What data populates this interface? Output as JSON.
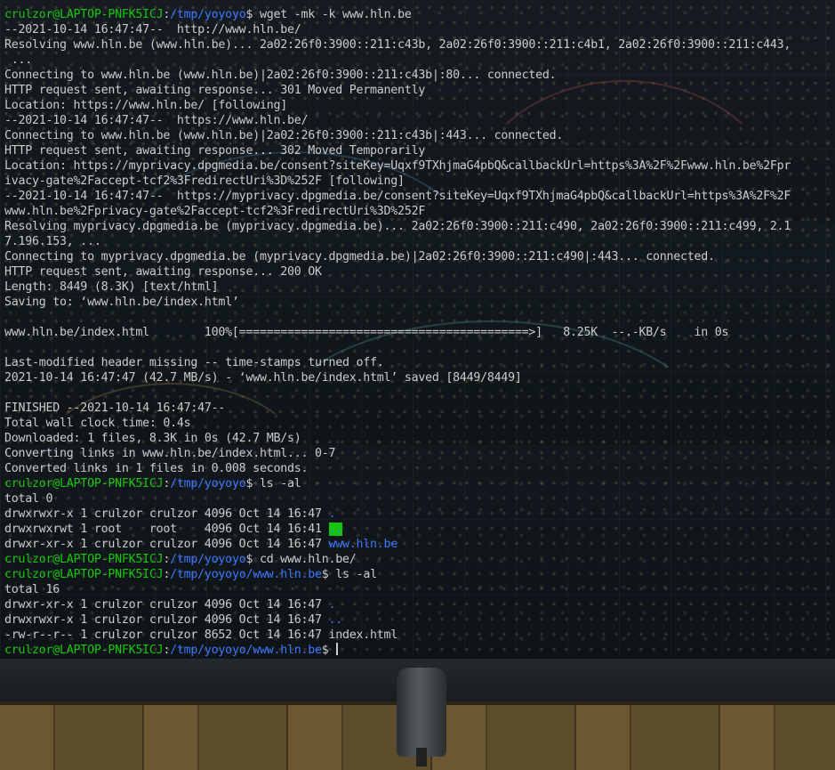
{
  "prompt": {
    "user_host": "crulzor@LAPTOP-PNFK5ICJ",
    "path_home": "/tmp/yoyoyo",
    "path_sub": "/tmp/yoyoyo/www.hln.be",
    "symbol": "$"
  },
  "commands": {
    "wget": "wget -mk -k www.hln.be",
    "ls1": "ls -al",
    "cd": "cd www.hln.be/",
    "ls2": "ls -al"
  },
  "wget_output": [
    "--2021-10-14 16:47:47--  http://www.hln.be/",
    "Resolving www.hln.be (www.hln.be)... 2a02:26f0:3900::211:c43b, 2a02:26f0:3900::211:c4b1, 2a02:26f0:3900::211:c443,",
    " ...",
    "Connecting to www.hln.be (www.hln.be)|2a02:26f0:3900::211:c43b|:80... connected.",
    "HTTP request sent, awaiting response... 301 Moved Permanently",
    "Location: https://www.hln.be/ [following]",
    "--2021-10-14 16:47:47--  https://www.hln.be/",
    "Connecting to www.hln.be (www.hln.be)|2a02:26f0:3900::211:c43b|:443... connected.",
    "HTTP request sent, awaiting response... 302 Moved Temporarily",
    "Location: https://myprivacy.dpgmedia.be/consent?siteKey=Uqxf9TXhjmaG4pbQ&callbackUrl=https%3A%2F%2Fwww.hln.be%2Fpr",
    "ivacy-gate%2Faccept-tcf2%3FredirectUri%3D%252F [following]",
    "--2021-10-14 16:47:47--  https://myprivacy.dpgmedia.be/consent?siteKey=Uqxf9TXhjmaG4pbQ&callbackUrl=https%3A%2F%2F",
    "www.hln.be%2Fprivacy-gate%2Faccept-tcf2%3FredirectUri%3D%252F",
    "Resolving myprivacy.dpgmedia.be (myprivacy.dpgmedia.be)... 2a02:26f0:3900::211:c490, 2a02:26f0:3900::211:c499, 2.1",
    "7.196.153, ...",
    "Connecting to myprivacy.dpgmedia.be (myprivacy.dpgmedia.be)|2a02:26f0:3900::211:c490|:443... connected.",
    "HTTP request sent, awaiting response... 200 OK",
    "Length: 8449 (8.3K) [text/html]",
    "Saving to: ‘www.hln.be/index.html’",
    "",
    "www.hln.be/index.html        100%[==========================================>]   8.25K  --.-KB/s    in 0s",
    "",
    "Last-modified header missing -- time-stamps turned off.",
    "2021-10-14 16:47:47 (42.7 MB/s) - ‘www.hln.be/index.html’ saved [8449/8449]",
    "",
    "FINISHED --2021-10-14 16:47:47--",
    "Total wall clock time: 0.4s",
    "Downloaded: 1 files, 8.3K in 0s (42.7 MB/s)",
    "Converting links in www.hln.be/index.html... 0-7",
    "Converted links in 1 files in 0.008 seconds."
  ],
  "download_progress": {
    "percent": 100,
    "file": "www.hln.be/index.html",
    "size": "8.25K"
  },
  "ls1_output": {
    "total": "total 0",
    "rows": [
      {
        "meta": "drwxrwxr-x 1 crulzor crulzor 4096 Oct 14 16:47 ",
        "name": "."
      },
      {
        "meta": "drwxrwxrwt 1 root    root    4096 Oct 14 16:41 ",
        "name": ".."
      },
      {
        "meta": "drwxr-xr-x 1 crulzor crulzor 4096 Oct 14 16:47 ",
        "name": "www.hln.be"
      }
    ]
  },
  "ls2_output": {
    "total": "total 16",
    "rows": [
      {
        "meta": "drwxr-xr-x 1 crulzor crulzor 4096 Oct 14 16:47 ",
        "name": "."
      },
      {
        "meta": "drwxrwxr-x 1 crulzor crulzor 4096 Oct 14 16:47 ",
        "name": ".."
      },
      {
        "meta": "-rw-r--r-- 1 crulzor crulzor 8652 Oct 14 16:47 ",
        "name": "index.html"
      }
    ]
  },
  "colors": {
    "user": "#16c60c",
    "path": "#3b78ff",
    "text": "#cccccc",
    "background": "#0f1418"
  },
  "background_scene": "modular synthesizer wall with desk and chair"
}
